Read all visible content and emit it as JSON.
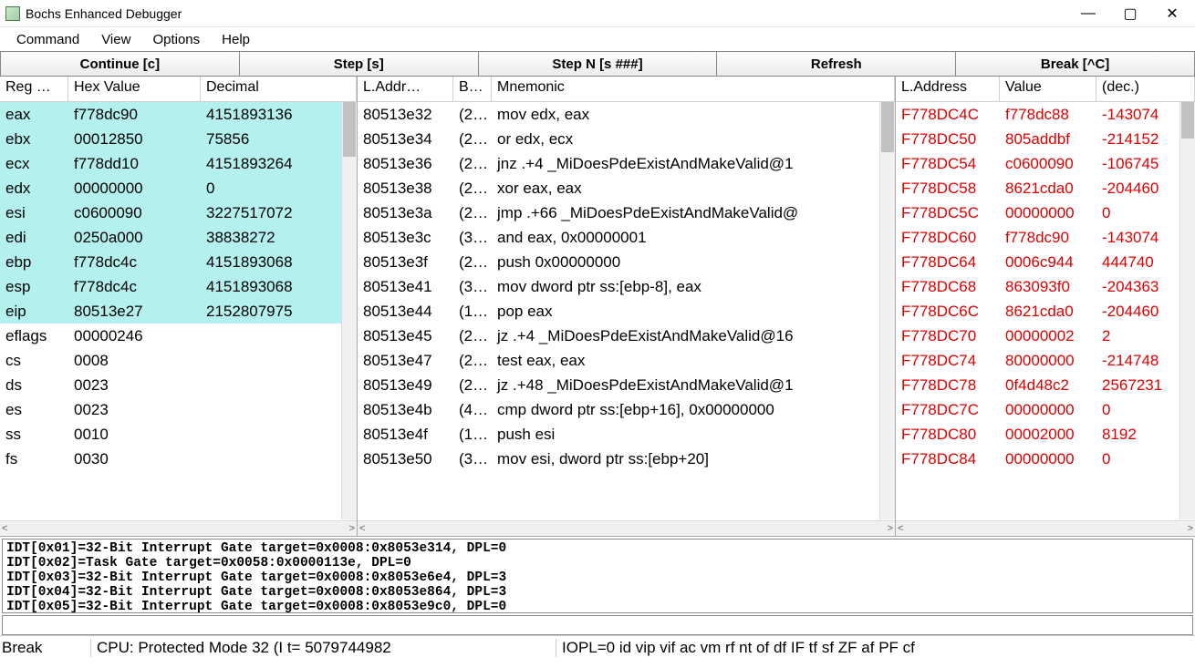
{
  "window": {
    "title": "Bochs Enhanced Debugger"
  },
  "menu": [
    "Command",
    "View",
    "Options",
    "Help"
  ],
  "toolbar": [
    "Continue [c]",
    "Step [s]",
    "Step N [s ###]",
    "Refresh",
    "Break [^C]"
  ],
  "regs": {
    "headers": [
      "Reg …",
      "Hex Value",
      "Decimal"
    ],
    "rows": [
      {
        "n": "eax",
        "h": "f778dc90",
        "d": "4151893136",
        "hl": true
      },
      {
        "n": "ebx",
        "h": "00012850",
        "d": "75856",
        "hl": true
      },
      {
        "n": "ecx",
        "h": "f778dd10",
        "d": "4151893264",
        "hl": true
      },
      {
        "n": "edx",
        "h": "00000000",
        "d": "0",
        "hl": true
      },
      {
        "n": "esi",
        "h": "c0600090",
        "d": "3227517072",
        "hl": true
      },
      {
        "n": "edi",
        "h": "0250a000",
        "d": "38838272",
        "hl": true
      },
      {
        "n": "ebp",
        "h": "f778dc4c",
        "d": "4151893068",
        "hl": true
      },
      {
        "n": "esp",
        "h": "f778dc4c",
        "d": "4151893068",
        "hl": true
      },
      {
        "n": "eip",
        "h": "80513e27",
        "d": "2152807975",
        "hl": true
      },
      {
        "n": "eflags",
        "h": "00000246",
        "d": "",
        "hl": false
      },
      {
        "n": "cs",
        "h": "0008",
        "d": "",
        "hl": false
      },
      {
        "n": "ds",
        "h": "0023",
        "d": "",
        "hl": false
      },
      {
        "n": "es",
        "h": "0023",
        "d": "",
        "hl": false
      },
      {
        "n": "ss",
        "h": "0010",
        "d": "",
        "hl": false
      },
      {
        "n": "fs",
        "h": "0030",
        "d": "",
        "hl": false
      }
    ]
  },
  "dis": {
    "headers": [
      "L.Addr…",
      "B…",
      "Mnemonic"
    ],
    "rows": [
      {
        "a": "80513e32",
        "b": "(2…",
        "m": "mov edx, eax"
      },
      {
        "a": "80513e34",
        "b": "(2…",
        "m": "or edx, ecx"
      },
      {
        "a": "80513e36",
        "b": "(2…",
        "m": "jnz .+4 _MiDoesPdeExistAndMakeValid@1"
      },
      {
        "a": "80513e38",
        "b": "(2…",
        "m": "xor eax, eax"
      },
      {
        "a": "80513e3a",
        "b": "(2…",
        "m": "jmp .+66 _MiDoesPdeExistAndMakeValid@"
      },
      {
        "a": "80513e3c",
        "b": "(3…",
        "m": "and eax, 0x00000001"
      },
      {
        "a": "80513e3f",
        "b": "(2…",
        "m": "push 0x00000000"
      },
      {
        "a": "80513e41",
        "b": "(3…",
        "m": "mov dword ptr ss:[ebp-8], eax"
      },
      {
        "a": "80513e44",
        "b": "(1…",
        "m": "pop eax"
      },
      {
        "a": "80513e45",
        "b": "(2…",
        "m": "jz .+4 _MiDoesPdeExistAndMakeValid@16"
      },
      {
        "a": "80513e47",
        "b": "(2…",
        "m": "test eax, eax"
      },
      {
        "a": "80513e49",
        "b": "(2…",
        "m": "jz .+48 _MiDoesPdeExistAndMakeValid@1"
      },
      {
        "a": "80513e4b",
        "b": "(4…",
        "m": "cmp dword ptr ss:[ebp+16], 0x00000000"
      },
      {
        "a": "80513e4f",
        "b": "(1…",
        "m": "push esi"
      },
      {
        "a": "80513e50",
        "b": "(3…",
        "m": "mov esi, dword ptr ss:[ebp+20]"
      }
    ]
  },
  "mem": {
    "headers": [
      "L.Address",
      "Value",
      "(dec.)"
    ],
    "rows": [
      {
        "a": "F778DC4C",
        "v": "f778dc88",
        "d": "-143074"
      },
      {
        "a": "F778DC50",
        "v": "805addbf",
        "d": "-214152"
      },
      {
        "a": "F778DC54",
        "v": "c0600090",
        "d": "-106745"
      },
      {
        "a": "F778DC58",
        "v": "8621cda0",
        "d": "-204460"
      },
      {
        "a": "F778DC5C",
        "v": "00000000",
        "d": "0"
      },
      {
        "a": "F778DC60",
        "v": "f778dc90",
        "d": "-143074"
      },
      {
        "a": "F778DC64",
        "v": "0006c944",
        "d": "444740"
      },
      {
        "a": "F778DC68",
        "v": "863093f0",
        "d": "-204363"
      },
      {
        "a": "F778DC6C",
        "v": "8621cda0",
        "d": "-204460"
      },
      {
        "a": "F778DC70",
        "v": "00000002",
        "d": "2"
      },
      {
        "a": "F778DC74",
        "v": "80000000",
        "d": "-214748"
      },
      {
        "a": "F778DC78",
        "v": "0f4d48c2",
        "d": "2567231"
      },
      {
        "a": "F778DC7C",
        "v": "00000000",
        "d": "0"
      },
      {
        "a": "F778DC80",
        "v": "00002000",
        "d": "8192"
      },
      {
        "a": "F778DC84",
        "v": "00000000",
        "d": "0"
      }
    ]
  },
  "log": "IDT[0x01]=32-Bit Interrupt Gate target=0x0008:0x8053e314, DPL=0\nIDT[0x02]=Task Gate target=0x0058:0x0000113e, DPL=0\nIDT[0x03]=32-Bit Interrupt Gate target=0x0008:0x8053e6e4, DPL=3\nIDT[0x04]=32-Bit Interrupt Gate target=0x0008:0x8053e864, DPL=3\nIDT[0x05]=32-Bit Interrupt Gate target=0x0008:0x8053e9c0, DPL=0",
  "status": {
    "s0": "Break",
    "s1": "CPU: Protected Mode 32 (I t= 5079744982",
    "s2": "IOPL=0 id vip vif ac vm rf nt of df IF tf sf ZF af PF cf"
  }
}
